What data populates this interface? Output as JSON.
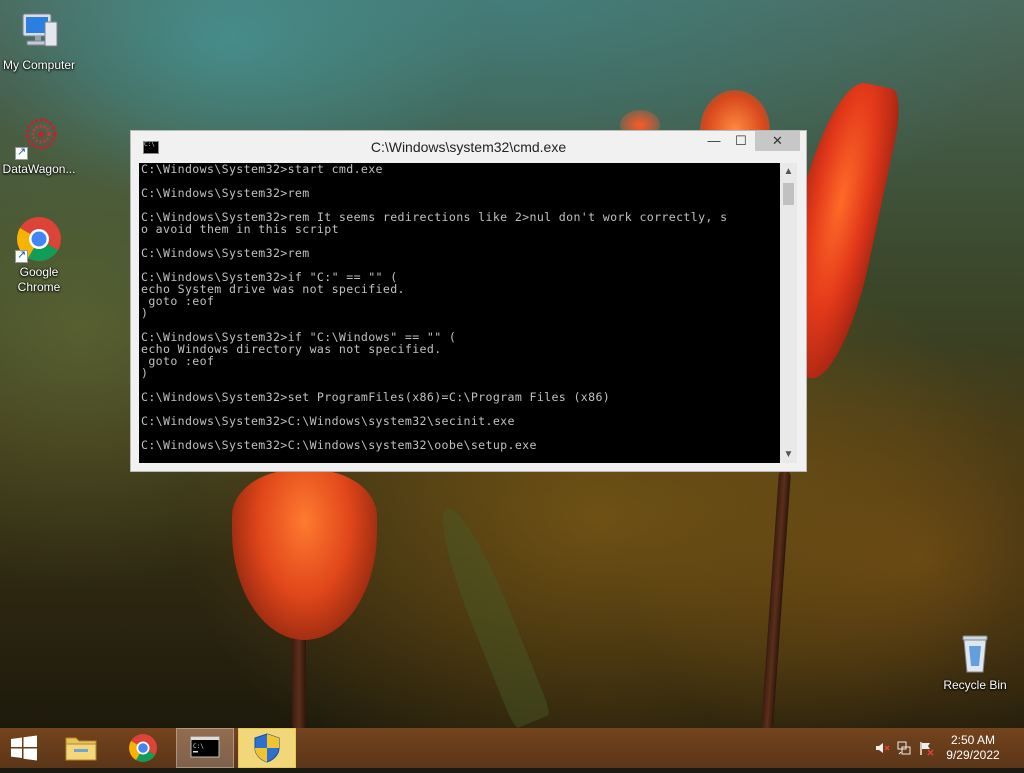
{
  "desktop": {
    "icons": [
      {
        "label": "My Computer",
        "icon": "computer-icon"
      },
      {
        "label": "DataWagon...",
        "icon": "datawagon-icon"
      },
      {
        "label": "Google\nChrome",
        "icon": "chrome-icon"
      },
      {
        "label": "Recycle Bin",
        "icon": "recycle-bin-icon"
      }
    ]
  },
  "cmd_window": {
    "title": "C:\\Windows\\system32\\cmd.exe",
    "icon": "console-icon",
    "icon_text": "C:\\",
    "minimize_glyph": "—",
    "maximize_glyph": "☐",
    "close_glyph": "✕",
    "scroll_up_glyph": "▲",
    "scroll_down_glyph": "▼",
    "console_lines": [
      "C:\\Windows\\System32>start cmd.exe",
      "",
      "C:\\Windows\\System32>rem",
      "",
      "C:\\Windows\\System32>rem It seems redirections like 2>nul don't work correctly, s",
      "o avoid them in this script",
      "",
      "C:\\Windows\\System32>rem",
      "",
      "C:\\Windows\\System32>if \"C:\" == \"\" (",
      "echo System drive was not specified.",
      " goto :eof",
      ")",
      "",
      "C:\\Windows\\System32>if \"C:\\Windows\" == \"\" (",
      "echo Windows directory was not specified.",
      " goto :eof",
      ")",
      "",
      "C:\\Windows\\System32>set ProgramFiles(x86)=C:\\Program Files (x86)",
      "",
      "C:\\Windows\\System32>C:\\Windows\\system32\\secinit.exe",
      "",
      "C:\\Windows\\System32>C:\\Windows\\system32\\oobe\\setup.exe"
    ]
  },
  "taskbar": {
    "items": [
      {
        "name": "start-button",
        "icon": "windows-logo-icon",
        "active": false
      },
      {
        "name": "file-explorer",
        "icon": "folder-icon",
        "active": false
      },
      {
        "name": "google-chrome",
        "icon": "chrome-icon",
        "active": false
      },
      {
        "name": "command-prompt",
        "icon": "console-icon",
        "active": true
      },
      {
        "name": "windows-setup",
        "icon": "shield-icon",
        "active": true
      }
    ],
    "tray": {
      "icons": [
        "speaker-muted-icon",
        "network-icon",
        "flag-icon"
      ],
      "time": "2:50 AM",
      "date": "9/29/2022"
    }
  },
  "colors": {
    "console_bg": "#000000",
    "console_text": "#c0c0c0",
    "close_button": "#c7c7c7",
    "taskbar": "#6e4020",
    "setup_highlight": "#f1d77a"
  }
}
